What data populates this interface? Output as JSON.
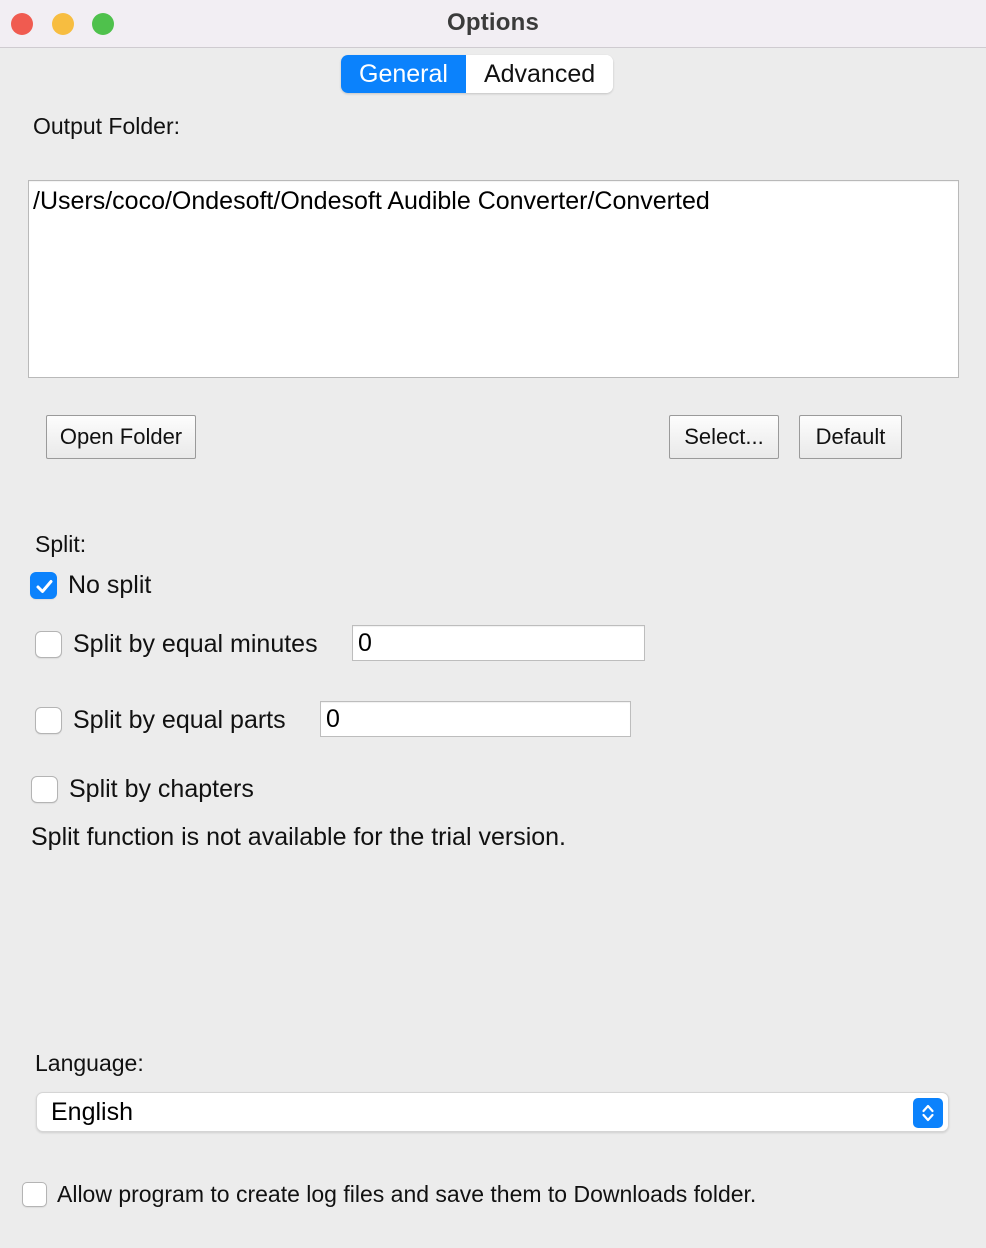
{
  "window": {
    "title": "Options",
    "traffic_lights": [
      {
        "name": "close",
        "color": "#f05b50"
      },
      {
        "name": "minimize",
        "color": "#f7bd40"
      },
      {
        "name": "zoom",
        "color": "#4fc14c"
      }
    ]
  },
  "tabs": [
    {
      "label": "General",
      "active": true
    },
    {
      "label": "Advanced",
      "active": false
    }
  ],
  "output_folder": {
    "label": "Output Folder:",
    "path": "/Users/coco/Ondesoft/Ondesoft Audible Converter/Converted"
  },
  "buttons": {
    "open_folder": "Open Folder",
    "select": "Select...",
    "default": "Default"
  },
  "split": {
    "label": "Split:",
    "options": [
      {
        "label": "No split",
        "checked": true
      },
      {
        "label": "Split by equal minutes",
        "checked": false,
        "value": "0"
      },
      {
        "label": "Split by equal parts",
        "checked": false,
        "value": "0"
      },
      {
        "label": "Split by chapters",
        "checked": false
      }
    ],
    "notice": "Split function is not available for the trial version."
  },
  "language": {
    "label": "Language:",
    "selected": "English"
  },
  "logging": {
    "label": "Allow program to create log files and save them to Downloads folder.",
    "checked": false
  },
  "colors": {
    "accent": "#0b82fc",
    "titlebar": "#f2eef3",
    "body": "#ececec"
  }
}
